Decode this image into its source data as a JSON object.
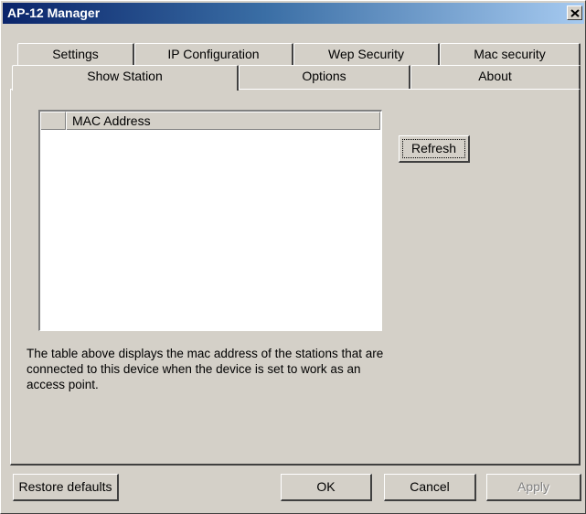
{
  "window": {
    "title": "AP-12 Manager"
  },
  "tabs": {
    "back_row": [
      "Settings",
      "IP Configuration",
      "Wep Security",
      "Mac security"
    ],
    "front_row": [
      "Show Station",
      "Options",
      "About"
    ],
    "selected": "Show Station"
  },
  "panel": {
    "list_header_column": "MAC Address",
    "refresh_label": "Refresh",
    "description": "The table above displays the mac address of the stations that are connected to this device when the device is set to work as an access point."
  },
  "footer": {
    "restore_label": "Restore defaults",
    "ok_label": "OK",
    "cancel_label": "Cancel",
    "apply_label": "Apply"
  },
  "icons": {
    "close": "close-icon"
  },
  "colors": {
    "title_gradient_start": "#0a246a",
    "title_gradient_end": "#a6caf0",
    "face": "#d4d0c8"
  }
}
